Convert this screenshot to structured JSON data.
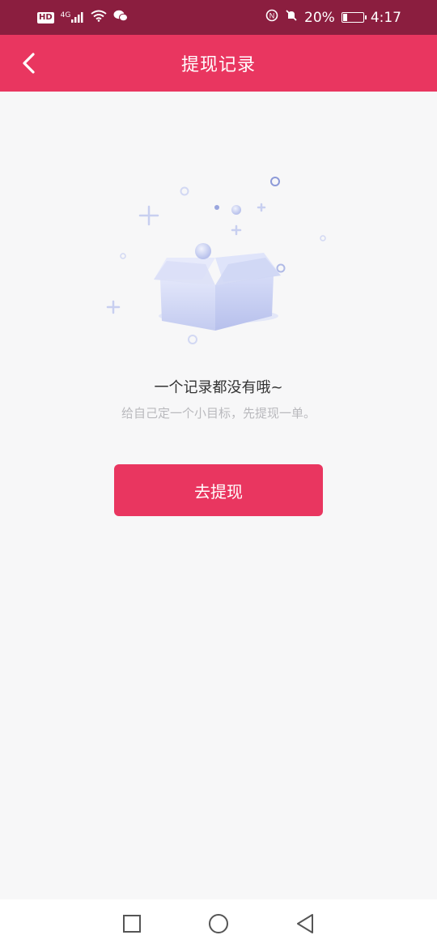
{
  "status_bar": {
    "hd": "HD",
    "network": "4G",
    "battery_percent": "20%",
    "battery_level": 0.2,
    "time": "4:17",
    "icons": [
      "hd-icon",
      "signal-icon",
      "wifi-icon",
      "wechat-icon",
      "nfc-icon",
      "mute-icon",
      "battery-icon"
    ]
  },
  "header": {
    "title": "提现记录",
    "back_icon": "chevron-left-icon"
  },
  "empty_state": {
    "illustration": "empty-box-icon",
    "title": "一个记录都没有哦~",
    "subtitle": "给自己定一个小目标，先提现一单。"
  },
  "action": {
    "withdraw_label": "去提现"
  },
  "system_nav": {
    "icons": [
      "recent-apps-icon",
      "home-icon",
      "back-icon"
    ]
  },
  "colors": {
    "status_bar": "#8b1e3f",
    "accent": "#e93660",
    "background": "#f7f7f8",
    "title_text": "#333333",
    "subtitle_text": "#b9b9bd",
    "illustration": "#c9d0f0"
  }
}
